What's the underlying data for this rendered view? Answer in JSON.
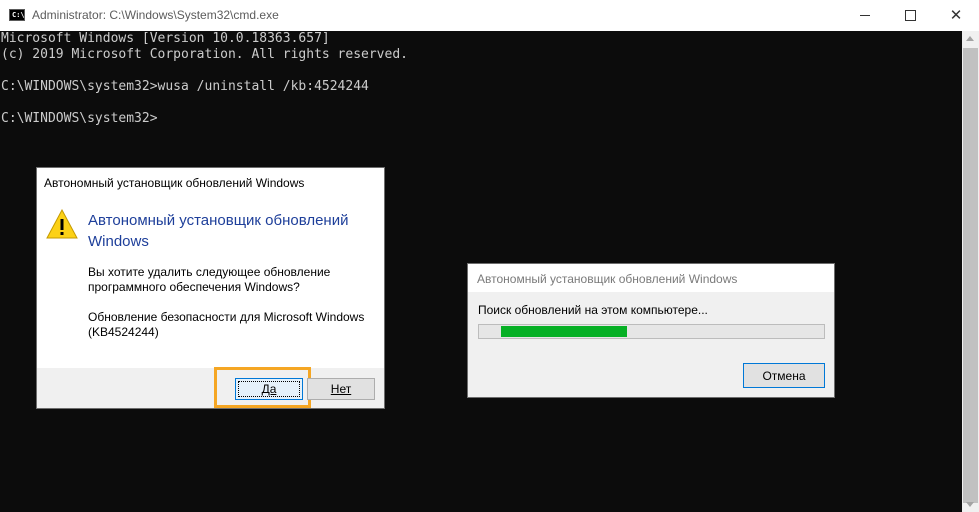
{
  "window": {
    "title": "Administrator: C:\\Windows\\System32\\cmd.exe",
    "icon_label": "C:\\."
  },
  "console": {
    "lines": [
      "Microsoft Windows [Version 10.0.18363.657]",
      "(c) 2019 Microsoft Corporation. All rights reserved.",
      "",
      "C:\\WINDOWS\\system32>wusa /uninstall /kb:4524244",
      "",
      "C:\\WINDOWS\\system32>"
    ]
  },
  "confirm_dialog": {
    "caption": "Автономный установщик обновлений Windows",
    "heading": "Автономный установщик обновлений Windows",
    "question": "Вы хотите удалить следующее обновление программного обеспечения Windows?",
    "update_name": "    Обновление безопасности для Microsoft Windows\n(KB4524244)",
    "yes_label": "Да",
    "no_label": "Нет",
    "highlight_color": "#f5a623"
  },
  "progress_dialog": {
    "caption": "Автономный установщик обновлений Windows",
    "message": "Поиск обновлений на этом компьютере...",
    "cancel_label": "Отмена",
    "progress_color": "#06b025"
  }
}
